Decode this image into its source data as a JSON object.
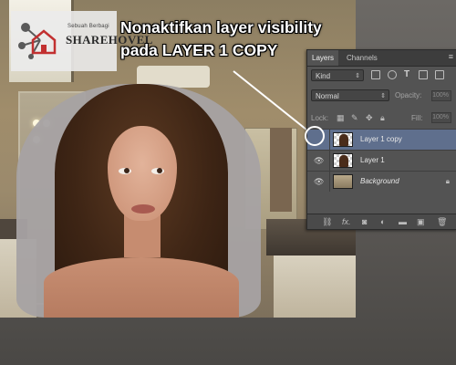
{
  "tutorial": {
    "title_line1": "Nonaktifkan layer visibility",
    "title_line2": "pada LAYER 1 COPY"
  },
  "logo": {
    "tagline": "Sebuah Berbagi",
    "name": "SHAREHOVEL"
  },
  "panel": {
    "tabs": [
      {
        "label": "Layers"
      },
      {
        "label": "Channels"
      }
    ],
    "menu_icon": "panel-menu-icon",
    "filter": {
      "value": "Kind"
    },
    "blend_mode": {
      "value": "Normal"
    },
    "opacity": {
      "label": "Opacity:",
      "value": "100%"
    },
    "lock": {
      "label": "Lock:"
    },
    "fill": {
      "label": "Fill:",
      "value": "100%"
    },
    "layers": [
      {
        "name": "Layer 1 copy",
        "visible": false,
        "selected": true
      },
      {
        "name": "Layer 1",
        "visible": true,
        "selected": false
      },
      {
        "name": "Background",
        "visible": true,
        "selected": false,
        "locked": true
      }
    ],
    "footer_icons": [
      "link-icon",
      "fx-icon",
      "mask-icon",
      "adjustment-icon",
      "group-icon",
      "new-layer-icon",
      "trash-icon"
    ],
    "footer_fx": "fx.",
    "colors": {
      "panel_bg": "#535353",
      "selected_row": "#5f6f8d",
      "highlight_circle": "#ffffff"
    }
  }
}
